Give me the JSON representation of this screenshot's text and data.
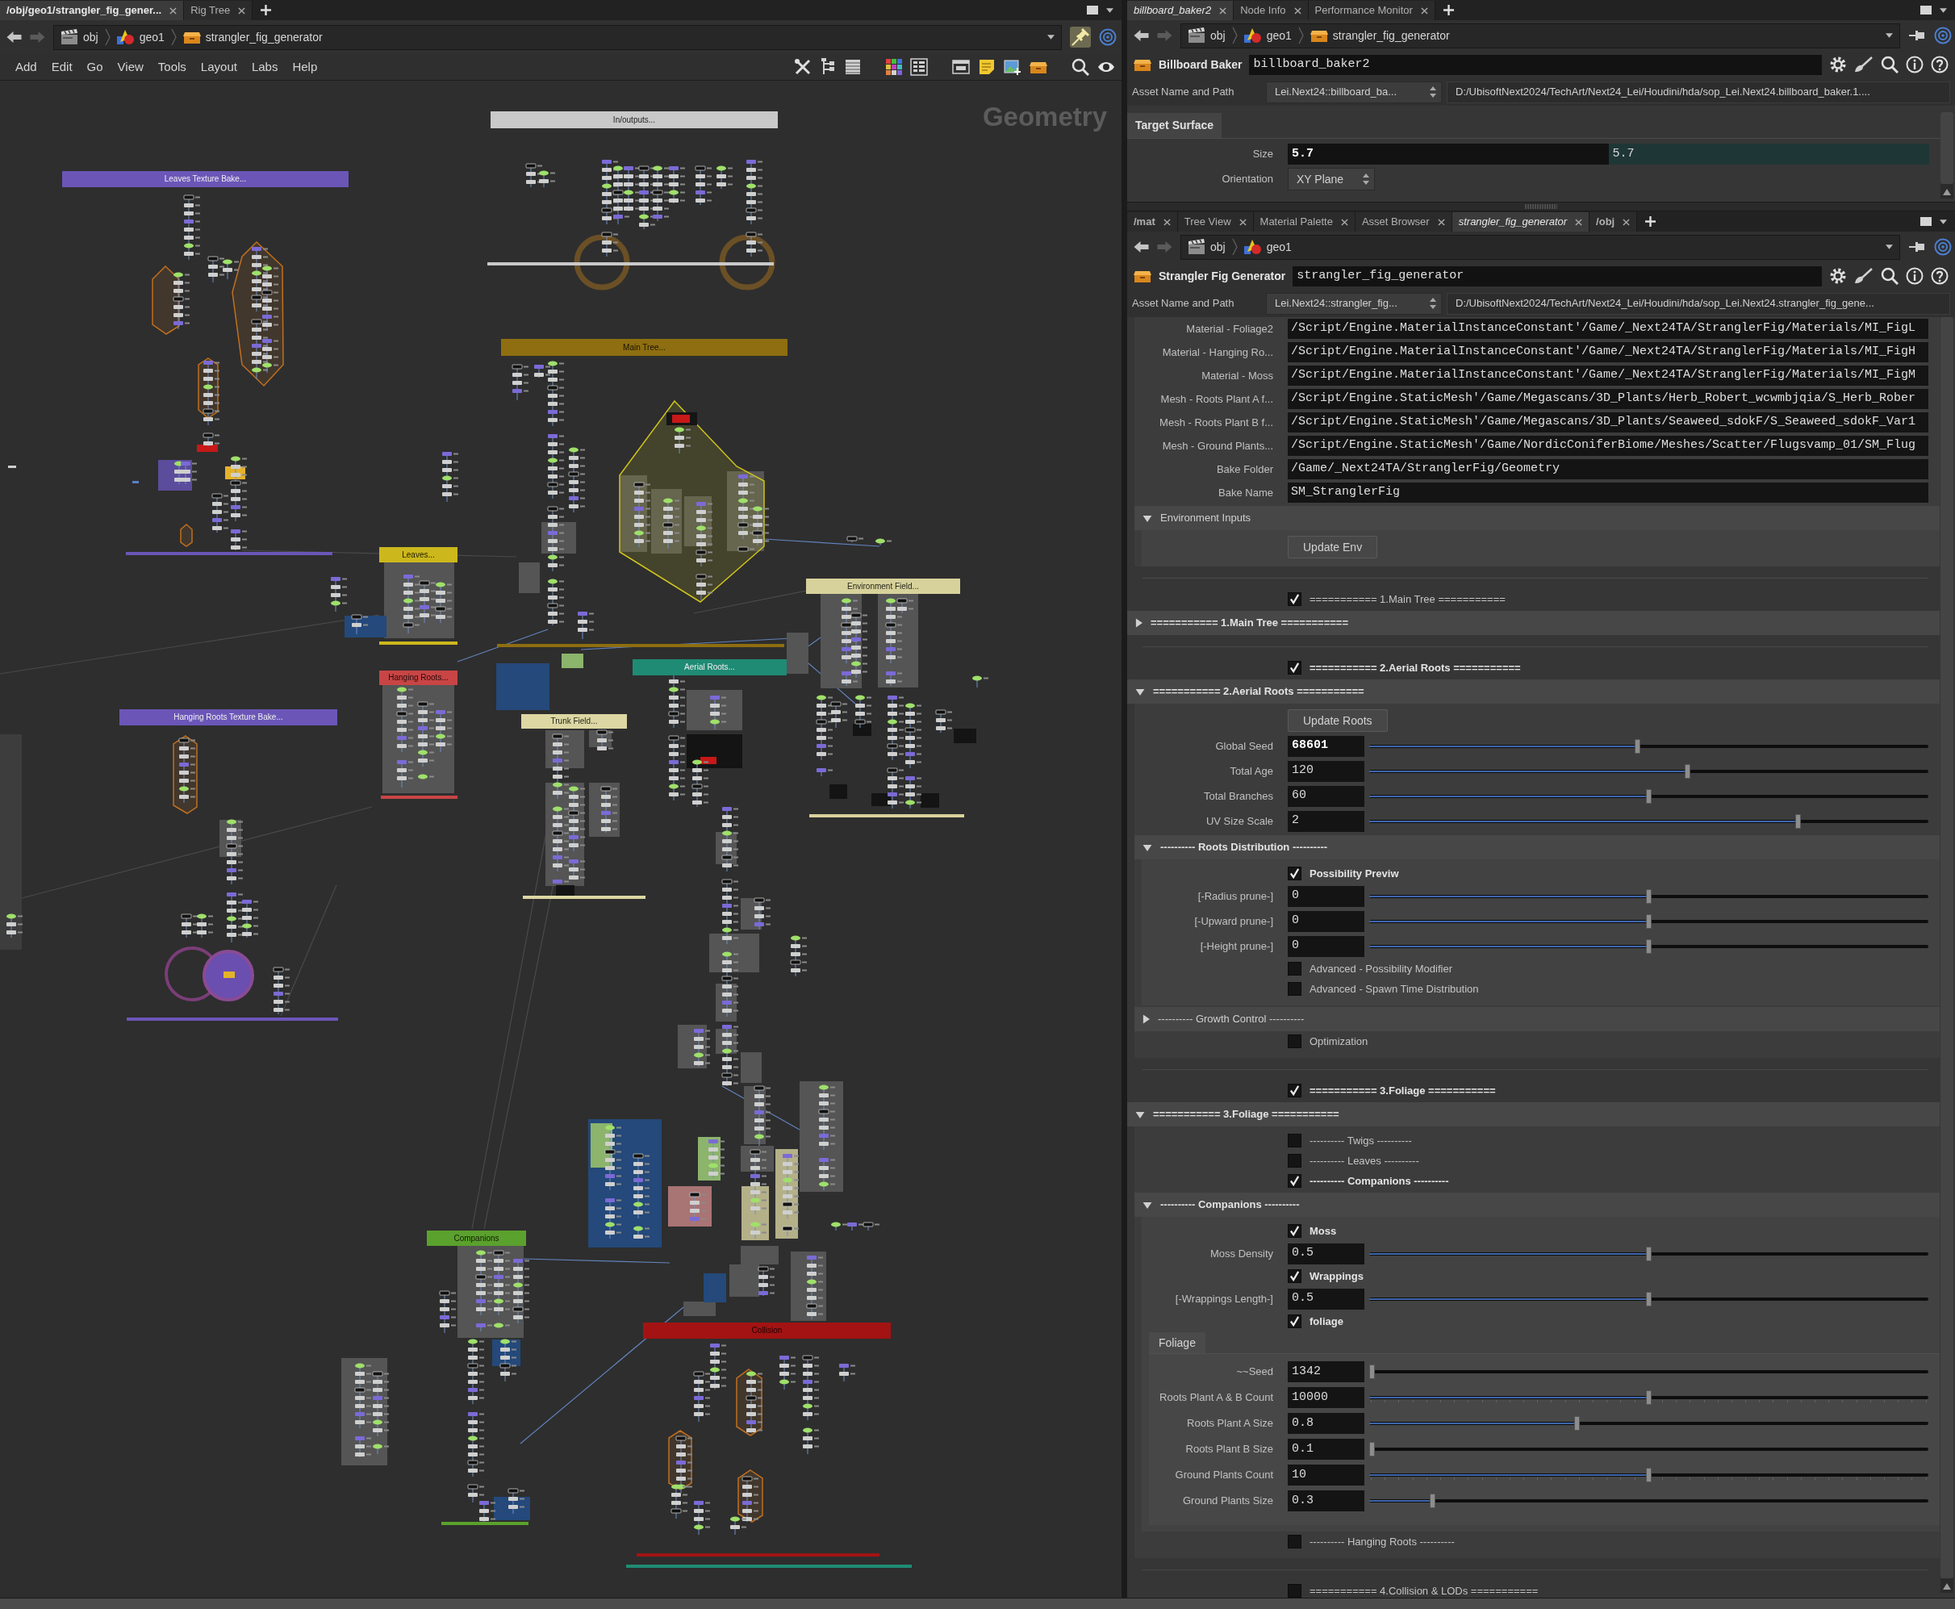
{
  "network_editor": {
    "tabs": [
      {
        "label": "/obj/geo1/strangler_fig_gener...",
        "kind": "network",
        "selected": true
      },
      {
        "label": "Rig Tree",
        "kind": "pane",
        "selected": false
      }
    ],
    "path": [
      {
        "label": "obj",
        "kind": "context"
      },
      {
        "label": "geo1",
        "kind": "object"
      },
      {
        "label": "strangler_fig_generator",
        "kind": "asset"
      }
    ],
    "menu": [
      "Add",
      "Edit",
      "Go",
      "View",
      "Tools",
      "Layout",
      "Labs",
      "Help"
    ],
    "context_label": "Geometry",
    "network_boxes": [
      {
        "label": "In/outputs...",
        "color": "#c9c9c9"
      },
      {
        "label": "Leaves Texture Bake...",
        "color": "#6b56b8"
      },
      {
        "label": "Main Tree...",
        "color": "#8e6e10"
      },
      {
        "label": "Leaves...",
        "color": "#ccb81d"
      },
      {
        "label": "Environment Field...",
        "color": "#d7d29b"
      },
      {
        "label": "Aerial Roots...",
        "color": "#1f8b74"
      },
      {
        "label": "Hanging Roots...",
        "color": "#c94545"
      },
      {
        "label": "Hanging Roots Texture Bake...",
        "color": "#6b56b8"
      },
      {
        "label": "Trunk Field...",
        "color": "#dcd7a3"
      },
      {
        "label": "Companions",
        "color": "#5ba12d"
      },
      {
        "label": "Collision",
        "color": "#a31313"
      }
    ]
  },
  "parameter_panes": [
    {
      "tabs": [
        {
          "label": "billboard_baker2",
          "kind": "node",
          "selected": true
        },
        {
          "label": "Node Info",
          "kind": "pane",
          "selected": false
        },
        {
          "label": "Performance Monitor",
          "kind": "pane",
          "selected": false
        }
      ],
      "path": [
        {
          "label": "obj",
          "kind": "context"
        },
        {
          "label": "geo1",
          "kind": "object"
        },
        {
          "label": "strangler_fig_generator",
          "kind": "asset"
        }
      ],
      "node_type": "Billboard Baker",
      "node_name": "billboard_baker2",
      "asset_label": "Asset Name and Path",
      "asset_name": "Lei.Next24::billboard_ba...",
      "asset_path": "D:/UbisoftNext2024/TechArt/Next24_Lei/Houdini/hda/sop_Lei.Next24.billboard_baker.1....",
      "folder_tabs": [
        {
          "label": "Target Surface",
          "selected": true
        }
      ],
      "parameters": [
        {
          "kind": "vector",
          "label": "Size",
          "values": [
            {
              "value": "5.7",
              "modified": true,
              "expression": false
            },
            {
              "value": "5.7",
              "modified": false,
              "expression": true
            }
          ]
        },
        {
          "kind": "menu",
          "label": "Orientation",
          "value": "XY Plane"
        }
      ]
    },
    {
      "tabs": [
        {
          "label": "/mat",
          "kind": "network",
          "selected": false
        },
        {
          "label": "Tree View",
          "kind": "pane",
          "selected": false
        },
        {
          "label": "Material Palette",
          "kind": "pane",
          "selected": false
        },
        {
          "label": "Asset Browser",
          "kind": "pane",
          "selected": false
        },
        {
          "label": "strangler_fig_generator",
          "kind": "node",
          "selected": true
        },
        {
          "label": "/obj",
          "kind": "network",
          "selected": false
        }
      ],
      "path": [
        {
          "label": "obj",
          "kind": "context"
        },
        {
          "label": "geo1",
          "kind": "object"
        }
      ],
      "node_type": "Strangler Fig Generator",
      "node_name": "strangler_fig_generator",
      "asset_label": "Asset Name and Path",
      "asset_name": "Lei.Next24::strangler_fig...",
      "asset_path": "D:/UbisoftNext2024/TechArt/Next24_Lei/Houdini/hda/sop_Lei.Next24.strangler_fig_gene...",
      "folder_contents": [
        {
          "kind": "string",
          "label": "Material - Foliage2",
          "value": "/Script/Engine.MaterialInstanceConstant'/Game/_Next24TA/StranglerFig/Materials/MI_FigL"
        },
        {
          "kind": "string",
          "label": "Material - Hanging Ro...",
          "value": "/Script/Engine.MaterialInstanceConstant'/Game/_Next24TA/StranglerFig/Materials/MI_FigH"
        },
        {
          "kind": "string",
          "label": "Material - Moss",
          "value": "/Script/Engine.MaterialInstanceConstant'/Game/_Next24TA/StranglerFig/Materials/MI_FigM"
        },
        {
          "kind": "string",
          "label": "Mesh - Roots Plant A f...",
          "value": "/Script/Engine.StaticMesh'/Game/Megascans/3D_Plants/Herb_Robert_wcwmbjqia/S_Herb_Rober"
        },
        {
          "kind": "string",
          "label": "Mesh - Roots Plant B f...",
          "value": "/Script/Engine.StaticMesh'/Game/Megascans/3D_Plants/Seaweed_sdokF/S_Seaweed_sdokF_Var1"
        },
        {
          "kind": "string",
          "label": "Mesh - Ground Plants...",
          "value": "/Script/Engine.StaticMesh'/Game/NordicConiferBiome/Meshes/Scatter/Flugsvamp_01/SM_Flug"
        },
        {
          "kind": "string",
          "label": "Bake Folder",
          "value": "/Game/_Next24TA/StranglerFig/Geometry"
        },
        {
          "kind": "string",
          "label": "Bake Name",
          "value": "SM_StranglerFig"
        },
        {
          "kind": "folder",
          "label": "Environment Inputs",
          "expanded": true,
          "modified": false,
          "children": [
            {
              "kind": "button",
              "label": "Update Env"
            }
          ]
        }
      ],
      "parameters": [
        {
          "kind": "separator"
        },
        {
          "kind": "toggle",
          "label": "=========== 1.Main Tree ===========",
          "checked": true,
          "modified": false
        },
        {
          "kind": "folder",
          "label": "=========== 1.Main Tree ===========",
          "expanded": false,
          "modified": true
        },
        {
          "kind": "separator"
        },
        {
          "kind": "toggle",
          "label": "=========== 2.Aerial Roots ===========",
          "checked": true,
          "modified": true
        },
        {
          "kind": "folder",
          "label": "=========== 2.Aerial Roots ===========",
          "expanded": true,
          "modified": true,
          "children": [
            {
              "kind": "button",
              "label": "Update Roots"
            },
            {
              "kind": "slider",
              "label": "Global Seed",
              "value": "68601",
              "level": 0.48,
              "modified": true
            },
            {
              "kind": "slider",
              "label": "Total Age",
              "value": "120",
              "level": 0.57,
              "modified": false
            },
            {
              "kind": "slider",
              "label": "Total Branches",
              "value": "60",
              "level": 0.5,
              "modified": false
            },
            {
              "kind": "slider",
              "label": "UV Size Scale",
              "value": "2",
              "level": 0.77,
              "modified": false
            },
            {
              "kind": "folder",
              "label": "---------- Roots Distribution ----------",
              "expanded": true,
              "modified": true,
              "children": [
                {
                  "kind": "toggle",
                  "label": "Possibility Previw",
                  "checked": true,
                  "modified": true
                },
                {
                  "kind": "slider",
                  "label": "[-Radius prune-]",
                  "value": "0",
                  "level": 0.5,
                  "modified": false
                },
                {
                  "kind": "slider",
                  "label": "[-Upward prune-]",
                  "value": "0",
                  "level": 0.5,
                  "modified": false
                },
                {
                  "kind": "slider",
                  "label": "[-Height prune-]",
                  "value": "0",
                  "level": 0.5,
                  "modified": false
                },
                {
                  "kind": "toggle",
                  "label": "Advanced - Possibility Modifier",
                  "checked": false,
                  "modified": false
                },
                {
                  "kind": "toggle",
                  "label": "Advanced - Spawn Time Distribution",
                  "checked": false,
                  "modified": false
                }
              ]
            },
            {
              "kind": "folder",
              "label": "---------- Growth Control ----------",
              "expanded": false,
              "modified": false
            },
            {
              "kind": "toggle",
              "label": "Optimization",
              "checked": false,
              "modified": false
            }
          ]
        },
        {
          "kind": "separator"
        },
        {
          "kind": "toggle",
          "label": "=========== 3.Foliage ===========",
          "checked": true,
          "modified": true
        },
        {
          "kind": "folder",
          "label": "=========== 3.Foliage ===========",
          "expanded": true,
          "modified": true,
          "children": [
            {
              "kind": "toggle",
              "label": "---------- Twigs ----------",
              "checked": false,
              "modified": false
            },
            {
              "kind": "toggle",
              "label": "---------- Leaves ----------",
              "checked": false,
              "modified": false
            },
            {
              "kind": "toggle",
              "label": "---------- Companions ----------",
              "checked": true,
              "modified": true
            },
            {
              "kind": "folder",
              "label": "---------- Companions ----------",
              "expanded": true,
              "modified": true,
              "children": [
                {
                  "kind": "toggle",
                  "label": "Moss",
                  "checked": true,
                  "modified": true
                },
                {
                  "kind": "slider",
                  "label": "Moss Density",
                  "value": "0.5",
                  "level": 0.5,
                  "modified": false
                },
                {
                  "kind": "toggle",
                  "label": "Wrappings",
                  "checked": true,
                  "modified": true
                },
                {
                  "kind": "slider",
                  "label": "[-Wrappings Length-]",
                  "value": "0.5",
                  "level": 0.5,
                  "modified": false
                },
                {
                  "kind": "toggle",
                  "label": "foliage",
                  "checked": true,
                  "modified": true
                },
                {
                  "kind": "tabs",
                  "tabs": [
                    {
                      "label": "Foliage",
                      "selected": true
                    }
                  ],
                  "children": [
                    {
                      "kind": "slider",
                      "label": "~~Seed",
                      "value": "1342",
                      "level": 0,
                      "modified": false
                    },
                    {
                      "kind": "slider",
                      "label": "Roots Plant A & B Count",
                      "value": "10000",
                      "level": 0.5,
                      "modified": false,
                      "ticks": true
                    },
                    {
                      "kind": "slider",
                      "label": "Roots Plant A Size",
                      "value": "0.8",
                      "level": 0.37,
                      "modified": false
                    },
                    {
                      "kind": "slider",
                      "label": "Roots Plant B Size",
                      "value": "0.1",
                      "level": 0,
                      "modified": false
                    },
                    {
                      "kind": "slider",
                      "label": "Ground Plants Count",
                      "value": "10",
                      "level": 0.5,
                      "modified": false,
                      "ticks": true
                    },
                    {
                      "kind": "slider",
                      "label": "Ground Plants Size",
                      "value": "0.3",
                      "level": 0.11,
                      "modified": false
                    }
                  ]
                }
              ]
            },
            {
              "kind": "toggle",
              "label": "---------- Hanging Roots ----------",
              "checked": false,
              "modified": false
            }
          ]
        },
        {
          "kind": "separator"
        },
        {
          "kind": "toggle",
          "label": "=========== 4.Collision & LODs ===========",
          "checked": false,
          "modified": false
        }
      ]
    }
  ]
}
